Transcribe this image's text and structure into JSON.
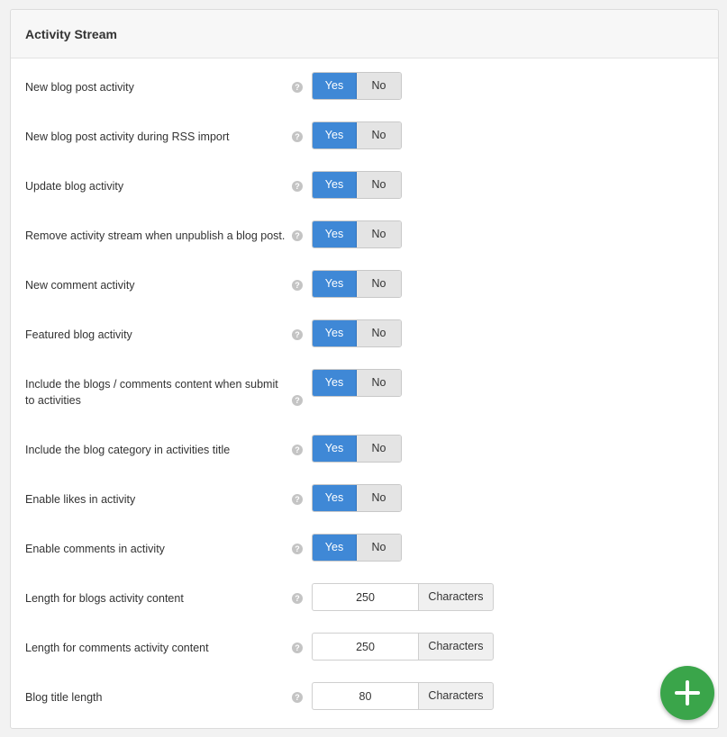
{
  "panel": {
    "title": "Activity Stream"
  },
  "toggle_labels": {
    "yes": "Yes",
    "no": "No"
  },
  "help_glyph": "?",
  "rows": [
    {
      "label": "New blog post activity",
      "type": "toggle",
      "value": "Yes"
    },
    {
      "label": "New blog post activity during RSS import",
      "type": "toggle",
      "value": "Yes"
    },
    {
      "label": "Update blog activity",
      "type": "toggle",
      "value": "Yes"
    },
    {
      "label": "Remove activity stream when unpublish a blog post.",
      "type": "toggle",
      "value": "Yes"
    },
    {
      "label": "New comment activity",
      "type": "toggle",
      "value": "Yes"
    },
    {
      "label": "Featured blog activity",
      "type": "toggle",
      "value": "Yes"
    },
    {
      "label": "Include the blogs / comments content when submit to activities",
      "type": "toggle",
      "value": "Yes"
    },
    {
      "label": "Include the blog category in activities title",
      "type": "toggle",
      "value": "Yes"
    },
    {
      "label": "Enable likes in activity",
      "type": "toggle",
      "value": "Yes"
    },
    {
      "label": "Enable comments in activity",
      "type": "toggle",
      "value": "Yes"
    },
    {
      "label": "Length for blogs activity content",
      "type": "number",
      "value": "250",
      "unit": "Characters"
    },
    {
      "label": "Length for comments activity content",
      "type": "number",
      "value": "250",
      "unit": "Characters"
    },
    {
      "label": "Blog title length",
      "type": "number",
      "value": "80",
      "unit": "Characters"
    }
  ],
  "colors": {
    "active_toggle": "#3f88d6",
    "fab": "#3aa54a"
  },
  "fab_icon": "plus-icon"
}
